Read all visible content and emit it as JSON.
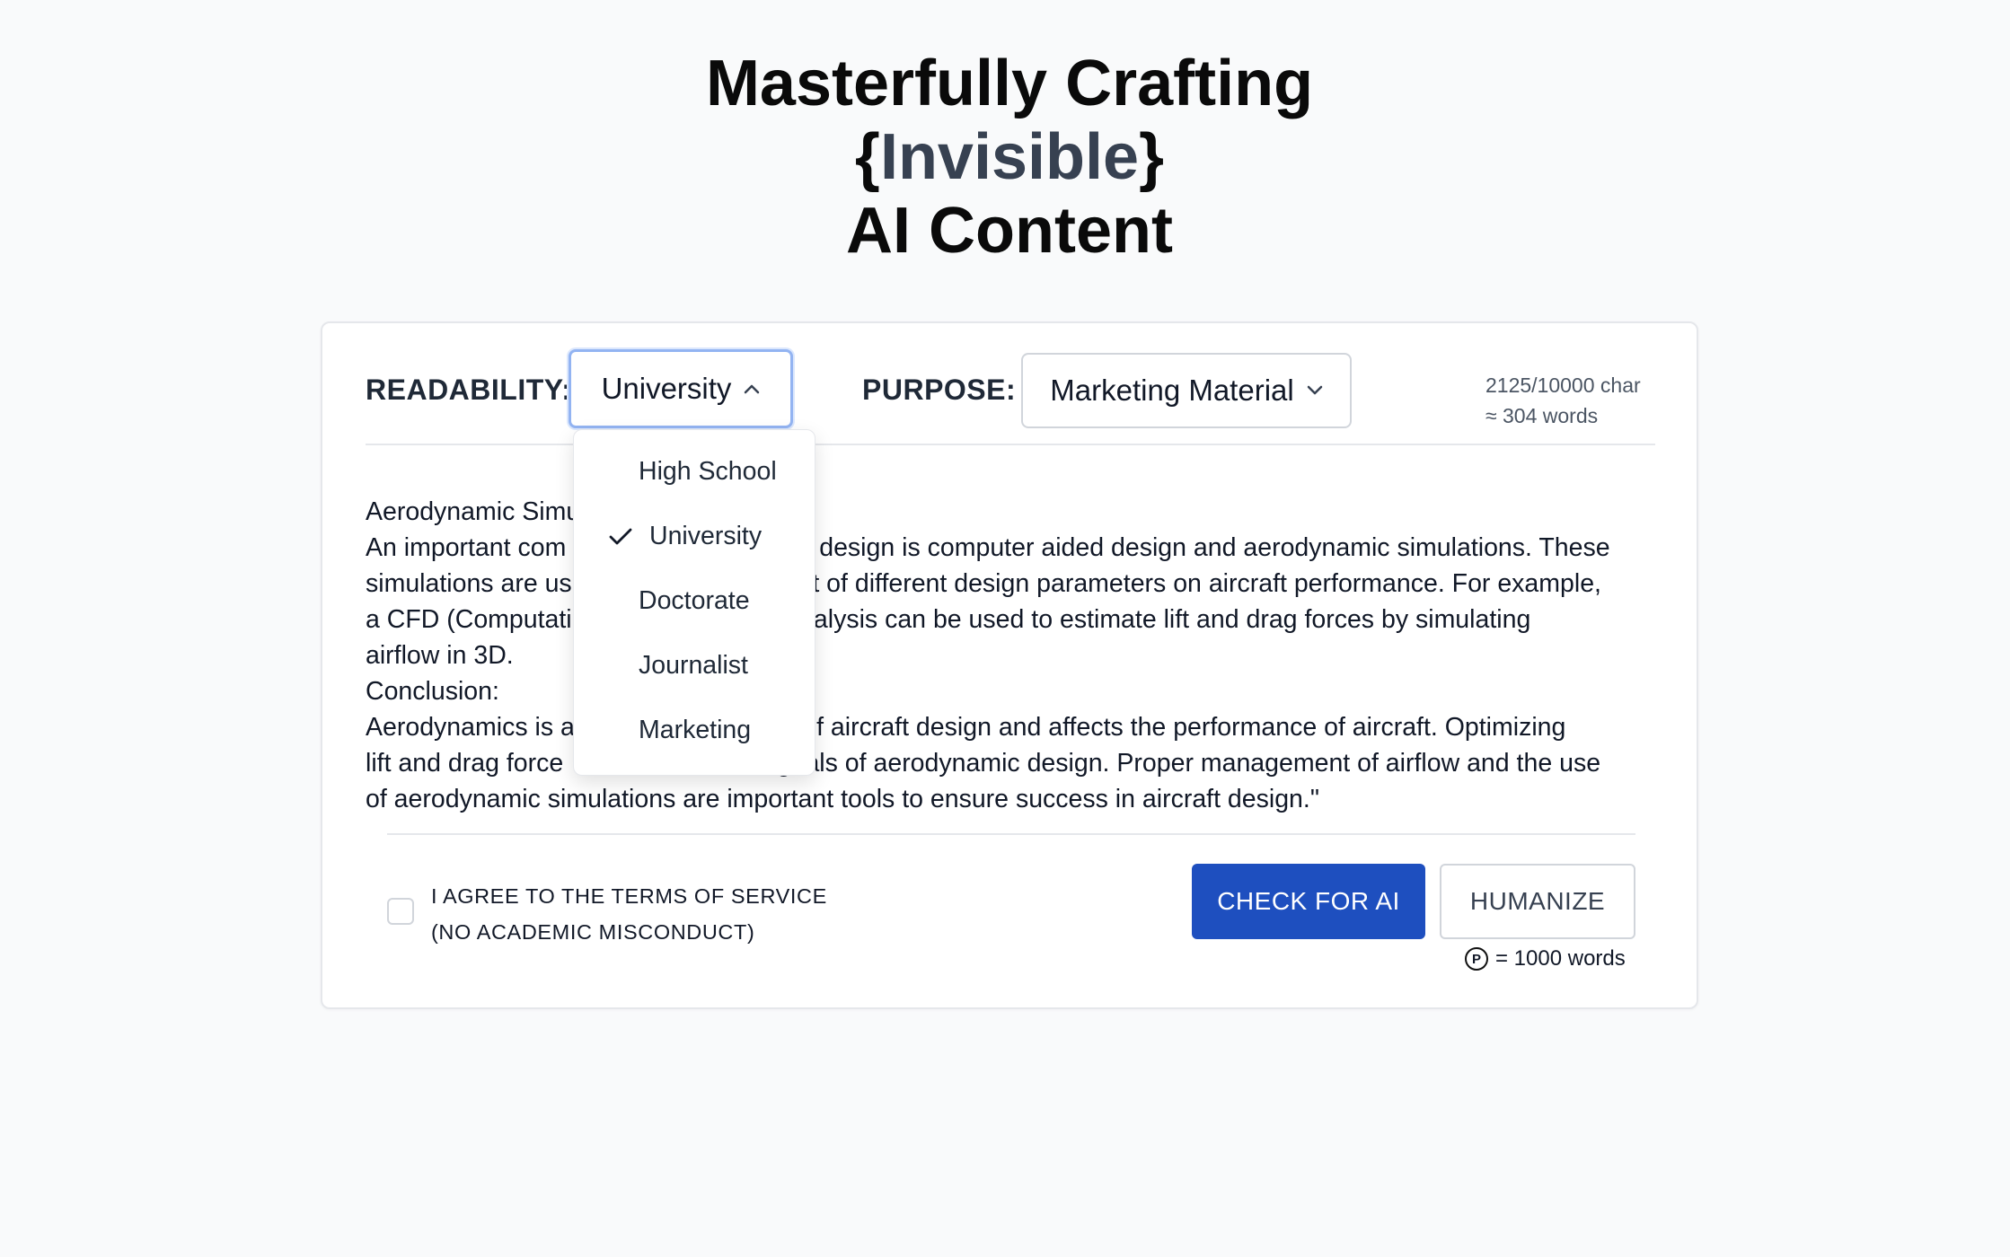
{
  "hero": {
    "line1": "Masterfully Crafting",
    "open_brace": "{",
    "line2_word": "Invisible",
    "close_brace": "}",
    "line3": "AI Content"
  },
  "controls": {
    "readability_label": "READABILITY:",
    "readability_value": "University",
    "purpose_label": "PURPOSE:",
    "purpose_value": "Marketing Material",
    "char_count": "2125/10000 char",
    "word_count": "≈ 304 words"
  },
  "readability_dropdown": {
    "options": [
      "High School",
      "University",
      "Doctorate",
      "Journalist",
      "Marketing"
    ],
    "selected": "University"
  },
  "content": {
    "lines": [
      "Aerodynamic Simu",
      "An important com                              nic design is computer aided design and aerodynamic simulations. These",
      "simulations are us                              ect of different design parameters on aircraft performance. For example,",
      "a CFD (Computati                              analysis can be used to estimate lift and drag forces by simulating",
      "airflow in 3D.",
      "Conclusion:",
      "Aerodynamics is a                              t of aircraft design and affects the performance of aircraft. Optimizing",
      "lift and drag force                              goals of aerodynamic design. Proper management of airflow and the use",
      "of aerodynamic simulations are important tools to ensure success in aircraft design.\""
    ]
  },
  "footer": {
    "terms_line1": "I AGREE TO THE TERMS OF SERVICE",
    "terms_line2": "(NO ACADEMIC MISCONDUCT)",
    "check_button": "CHECK FOR AI",
    "humanize_button": "HUMANIZE",
    "credit_symbol": "P",
    "credit_text": "= 1000 words"
  },
  "colors": {
    "primary_button": "#1e4fbf",
    "focus_ring": "#93b4f2",
    "background": "#f9fafb"
  }
}
